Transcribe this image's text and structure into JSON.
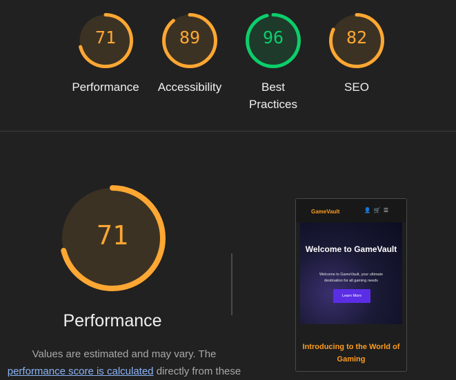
{
  "gauges": [
    {
      "score": "71",
      "label": "Performance",
      "value": 0.71,
      "color": "#ffa733",
      "bg": "#3b3223"
    },
    {
      "score": "89",
      "label": "Accessibility",
      "value": 0.89,
      "color": "#ffa733",
      "bg": "#3b3223"
    },
    {
      "score": "96",
      "label": "Best\nPractices",
      "value": 0.96,
      "color": "#0cce6b",
      "bg": "#1d3a2a"
    },
    {
      "score": "82",
      "label": "SEO",
      "value": 0.82,
      "color": "#ffa733",
      "bg": "#3b3223"
    }
  ],
  "performance": {
    "score": "71",
    "value": 0.71,
    "title": "Performance",
    "desc_pre": "Values are estimated and may vary. The",
    "desc_link": "performance score is calculated",
    "desc_post": "directly from these"
  },
  "screenshot": {
    "brand": "GameVault",
    "hero_title": "Welcome to GameVault",
    "hero_text": "Welcome to GameVault, your ultimate destination for all gaming needs",
    "button": "Learn More",
    "footer": "Introducing to the World of Gaming"
  },
  "colors": {
    "orange": "#ffa733",
    "green": "#0cce6b",
    "link": "#8ab4f8"
  }
}
